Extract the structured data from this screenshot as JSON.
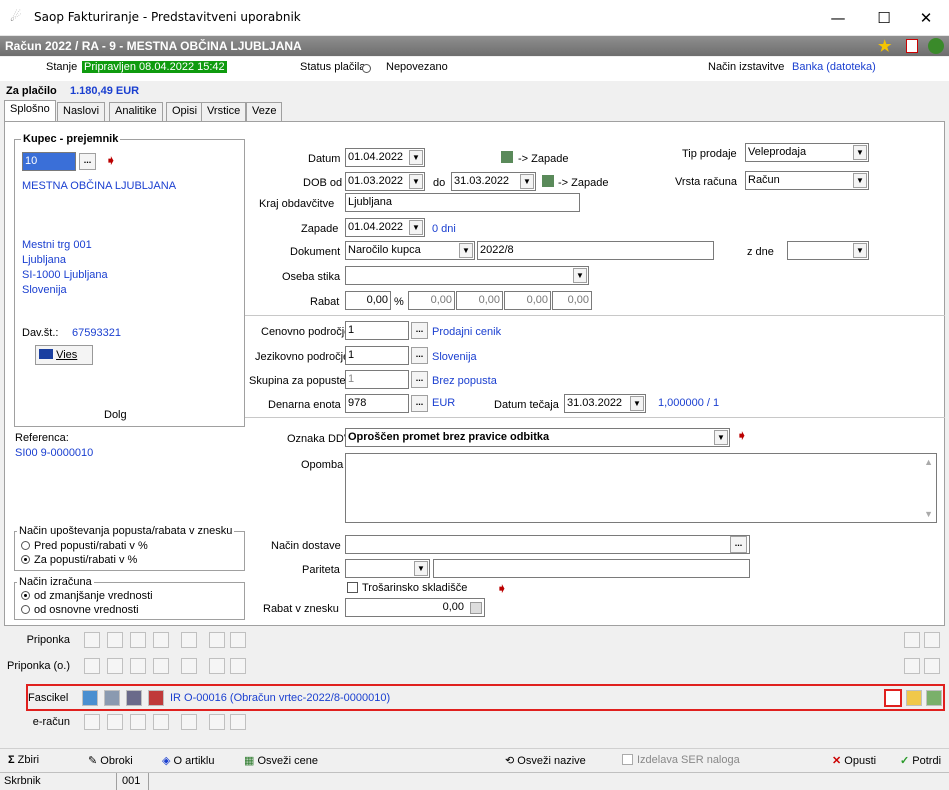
{
  "window": {
    "title": "Saop Fakturiranje - Predstavitveni uporabnik",
    "minimize": "—",
    "maximize": "☐",
    "close": "✕"
  },
  "doc": {
    "title": "Račun  2022 / RA - 9 - MESTNA OBČINA LJUBLJANA"
  },
  "info": {
    "stanje_label": "Stanje",
    "stanje_value": "Pripravljen 08.04.2022 15:42",
    "status_label": "Status plačila",
    "status_value": "Nepovezano",
    "nacin_label": "Način izstavitve",
    "nacin_value": "Banka (datoteka)",
    "placilo_label": "Za plačilo",
    "placilo_value": "1.180,49 EUR"
  },
  "tabs": [
    "Splošno",
    "Naslovi",
    "Analitike",
    "Opisi",
    "Vrstice",
    "Veze"
  ],
  "kupec": {
    "title": "Kupec - prejemnik",
    "code": "10",
    "name": "MESTNA OBČINA LJUBLJANA",
    "addr1": "Mestni trg 001",
    "addr2": "Ljubljana",
    "addr3": "SI-1000  Ljubljana",
    "addr4": "Slovenija",
    "davst_label": "Dav.št.:",
    "davst_value": "67593321",
    "vies": "Vies",
    "dolg": "Dolg"
  },
  "referenca": {
    "label": "Referenca:",
    "value": "SI00 9-0000010"
  },
  "form": {
    "datum_label": "Datum",
    "datum": "01.04.2022",
    "zapade_link": "-> Zapade",
    "dob_label": "DOB od",
    "dob_od": "01.03.2022",
    "do_label": "do",
    "dob_do": "31.03.2022",
    "kraj_label": "Kraj obdavčitve",
    "kraj": "Ljubljana",
    "zapade_label": "Zapade",
    "zapade": "01.04.2022",
    "zapade_dni": "0 dni",
    "dokument_label": "Dokument",
    "dokument": "Naročilo kupca",
    "dokument_st": "2022/8",
    "zdne_label": "z dne",
    "oseba_label": "Oseba stika",
    "rabat_label": "Rabat",
    "rabat": "0,00",
    "pct": "%",
    "rabat_vals": [
      "0,00",
      "0,00",
      "0,00",
      "0,00"
    ],
    "tip_label": "Tip prodaje",
    "tip": "Veleprodaja",
    "vrsta_label": "Vrsta računa",
    "vrsta": "Račun",
    "cen_label": "Cenovno področje",
    "cen": "1",
    "cen_desc": "Prodajni cenik",
    "jez_label": "Jezikovno področje",
    "jez": "1",
    "jez_desc": "Slovenija",
    "skup_label": "Skupina za popuste",
    "skup": "1",
    "skup_desc": "Brez popusta",
    "den_label": "Denarna enota",
    "den": "978",
    "den_desc": "EUR",
    "tecaj_label": "Datum tečaja",
    "tecaj_date": "31.03.2022",
    "tecaj_val": "1,000000   / 1",
    "ddv_label": "Oznaka DDV",
    "ddv": "Oproščen promet brez pravice odbitka",
    "opomba_label": "Opomba",
    "dostava_label": "Način dostave",
    "pariteta_label": "Pariteta",
    "trosar_label": "Trošarinsko skladišče",
    "rabatz_label": "Rabat v znesku",
    "rabatz": "0,00"
  },
  "popust_group": {
    "title": "Način upoštevanja popusta/rabata v znesku",
    "opt1": "Pred popusti/rabati v %",
    "opt2": "Za popusti/rabati v %"
  },
  "izracun_group": {
    "title": "Način izračuna",
    "opt1": "od zmanjšanje vrednosti",
    "opt2": "od osnovne vrednosti"
  },
  "attach": {
    "priponka": "Priponka",
    "priponka_o": "Priponka (o.)",
    "fascikel": "Fascikel",
    "fascikel_link": "IR O-00016 (Obračun vrtec-2022/8-0000010)",
    "eracun": "e-račun"
  },
  "highlight_color": "#e0201e",
  "bottom": {
    "zbiri": "Zbiri",
    "obroki": "Obroki",
    "oartiklu": "O artiklu",
    "osvezi_cene": "Osveži cene",
    "osvezi_nazive": "Osveži nazive",
    "izdelava": "Izdelava SER naloga",
    "opusti": "Opusti",
    "potrdi": "Potrdi"
  },
  "status": {
    "label": "Skrbnik",
    "value": "001"
  }
}
